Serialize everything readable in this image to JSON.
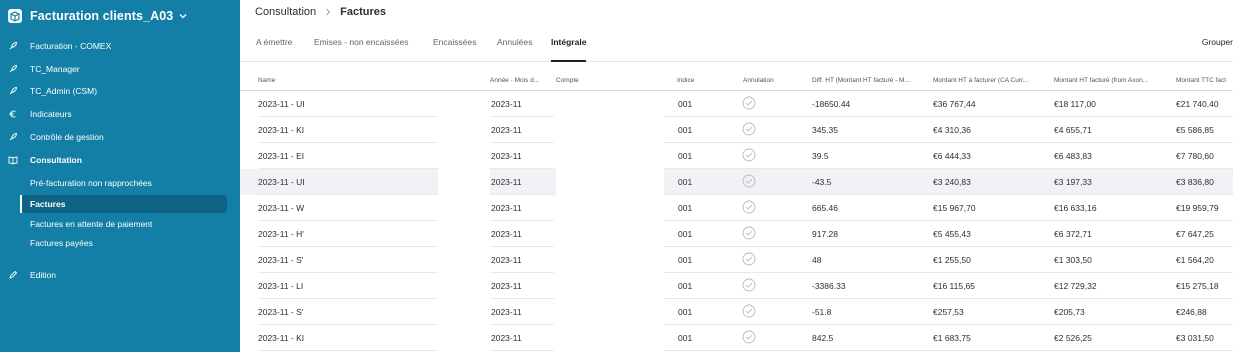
{
  "app": {
    "title": "Facturation clients_A03"
  },
  "sidebar": {
    "items": [
      {
        "label": "Facturation - COMEX",
        "icon": "rocket-icon"
      },
      {
        "label": "TC_Manager",
        "icon": "rocket-icon"
      },
      {
        "label": "TC_Admin (CSM)",
        "icon": "rocket-icon"
      },
      {
        "label": "Indicateurs",
        "icon": "euro-icon"
      },
      {
        "label": "Contrôle de gestion",
        "icon": "rocket-icon"
      },
      {
        "label": "Consultation",
        "icon": "book-icon"
      }
    ],
    "sub_items": [
      {
        "label": "Pré-facturation non rapprochées",
        "active": false
      },
      {
        "label": "Factures",
        "active": true
      },
      {
        "label": "Factures en attente de paiement",
        "active": false
      },
      {
        "label": "Factures payées",
        "active": false
      }
    ],
    "edition": {
      "label": "Edition",
      "icon": "pencil-icon"
    }
  },
  "breadcrumb": {
    "parent": "Consultation",
    "current": "Factures"
  },
  "tabs": [
    {
      "label": "A émettre",
      "active": false
    },
    {
      "label": "Emises - non encaissées",
      "active": false
    },
    {
      "label": "Encaissées",
      "active": false
    },
    {
      "label": "Annulées",
      "active": false
    },
    {
      "label": "Intégrale",
      "active": true
    }
  ],
  "toolbar": {
    "group_label": "Grouper"
  },
  "table": {
    "columns": [
      "Name",
      "Année - Mois d...",
      "Compte",
      "Indice",
      "Annulation",
      "Diff. HT (Montant HT facturé - M...",
      "Montant HT à facturer (CA Curr...",
      "Montant HT facturé (from Axon...",
      "Montant TTC fact"
    ],
    "rows": [
      {
        "name": "2023-11 - UI",
        "month": "2023-11",
        "indice": "001",
        "annulation": true,
        "diff": "-18650.44",
        "ht_a_facturer": "€36 767,44",
        "ht_facture": "€18 117,00",
        "ttc": "€21 740,40",
        "highlight": false
      },
      {
        "name": "2023-11 - KI",
        "month": "2023-11",
        "indice": "001",
        "annulation": true,
        "diff": "345.35",
        "ht_a_facturer": "€4 310,36",
        "ht_facture": "€4 655,71",
        "ttc": "€5 586,85",
        "highlight": false
      },
      {
        "name": "2023-11 - EI",
        "month": "2023-11",
        "indice": "001",
        "annulation": true,
        "diff": "39.5",
        "ht_a_facturer": "€6 444,33",
        "ht_facture": "€6 483,83",
        "ttc": "€7 780,60",
        "highlight": false
      },
      {
        "name": "2023-11 - UI",
        "month": "2023-11",
        "indice": "001",
        "annulation": true,
        "diff": "-43.5",
        "ht_a_facturer": "€3 240,83",
        "ht_facture": "€3 197,33",
        "ttc": "€3 836,80",
        "highlight": true
      },
      {
        "name": "2023-11 - W",
        "month": "2023-11",
        "indice": "001",
        "annulation": true,
        "diff": "665.46",
        "ht_a_facturer": "€15 967,70",
        "ht_facture": "€16 633,16",
        "ttc": "€19 959,79",
        "highlight": false
      },
      {
        "name": "2023-11 - H'",
        "month": "2023-11",
        "indice": "001",
        "annulation": true,
        "diff": "917.28",
        "ht_a_facturer": "€5 455,43",
        "ht_facture": "€6 372,71",
        "ttc": "€7 647,25",
        "highlight": false
      },
      {
        "name": "2023-11 - S'",
        "month": "2023-11",
        "indice": "001",
        "annulation": true,
        "diff": "48",
        "ht_a_facturer": "€1 255,50",
        "ht_facture": "€1 303,50",
        "ttc": "€1 564,20",
        "highlight": false
      },
      {
        "name": "2023-11 - LI",
        "month": "2023-11",
        "indice": "001",
        "annulation": true,
        "diff": "-3386.33",
        "ht_a_facturer": "€16 115,65",
        "ht_facture": "€12 729,32",
        "ttc": "€15 275,18",
        "highlight": false
      },
      {
        "name": "2023-11 - S'",
        "month": "2023-11",
        "indice": "001",
        "annulation": true,
        "diff": "-51.8",
        "ht_a_facturer": "€257,53",
        "ht_facture": "€205,73",
        "ttc": "€246,88",
        "highlight": false
      },
      {
        "name": "2023-11 - KI",
        "month": "2023-11",
        "indice": "001",
        "annulation": true,
        "diff": "842.5",
        "ht_a_facturer": "€1 683,75",
        "ht_facture": "€2 526,25",
        "ttc": "€3 031,50",
        "highlight": false
      }
    ]
  },
  "colors": {
    "sidebar_bg": "#137fa6",
    "sidebar_active": "#0f6485"
  }
}
